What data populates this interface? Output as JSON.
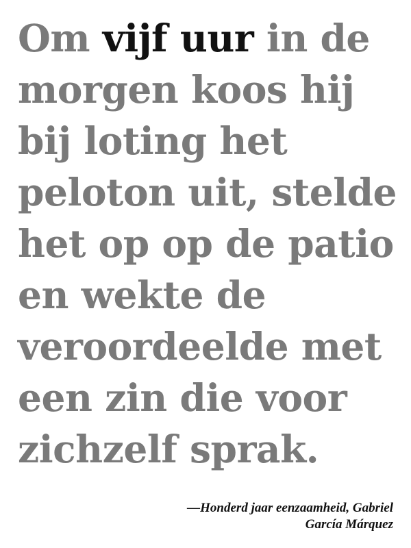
{
  "quote": {
    "line1": {
      "before": "Om ",
      "emphasis": "vijf uur",
      "after": " in de"
    },
    "lines": [
      "morgen koos hij",
      "bij loting het",
      "peloton uit, stelde",
      "het op op de patio",
      "en wekte de",
      "veroordeelde met",
      "een zin die voor",
      "zichzelf sprak."
    ]
  },
  "attribution": {
    "line1": "—Honderd jaar eenzaamheid, Gabriel",
    "line2": "García Márquez"
  },
  "colors": {
    "quote_text": "#7a7a7a",
    "emphasis_text": "#111111",
    "background": "#ffffff"
  }
}
